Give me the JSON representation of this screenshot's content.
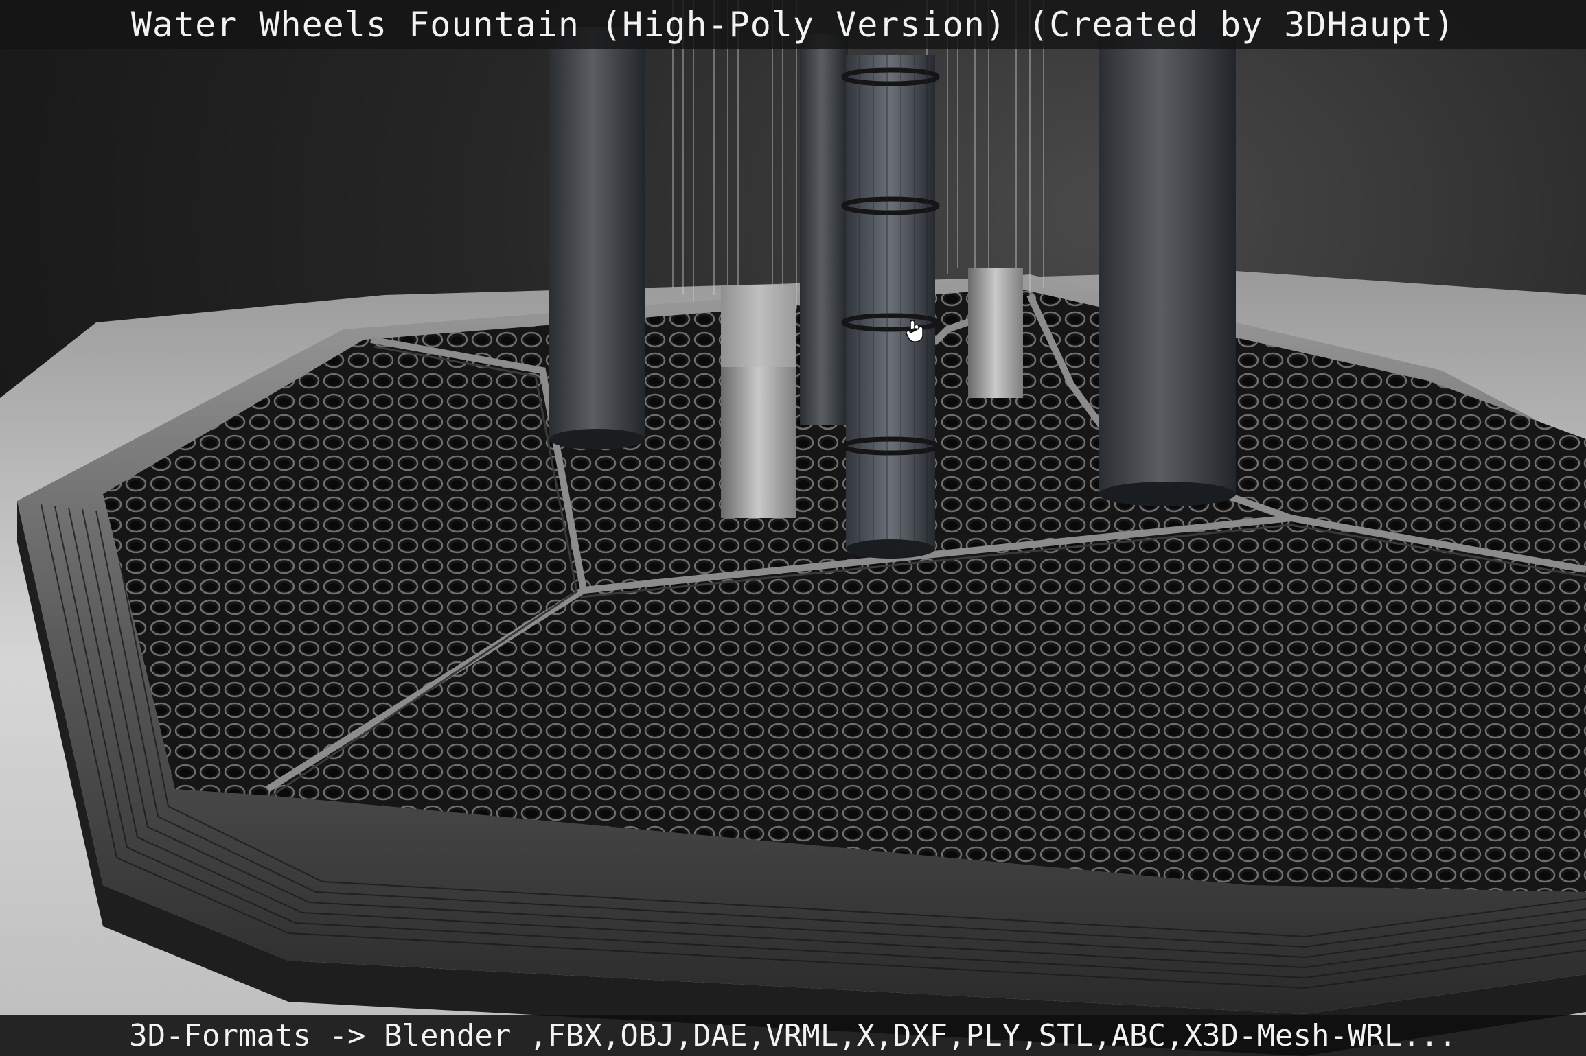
{
  "title": "Water Wheels Fountain (High-Poly Version) (Created by 3DHaupt)",
  "footer": "3D-Formats -> Blender ,FBX,OBJ,DAE,VRML,X,DXF,PLY,STL,ABC,X3D-Mesh-WRL...",
  "cursor_icon": "hand-pointer-icon",
  "colors": {
    "overlay_bg": "#141414",
    "overlay_text": "#f2f2f2",
    "floor": "#cfcfcf",
    "rim": "#7a7a7a",
    "basin": "#1c1c1c"
  }
}
